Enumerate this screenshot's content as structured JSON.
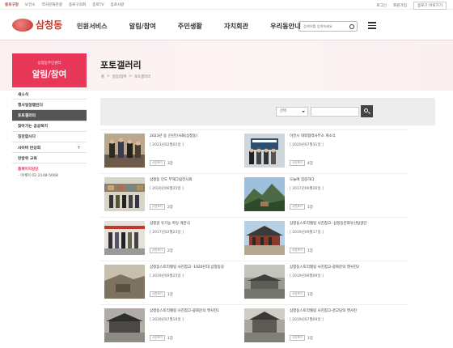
{
  "utility": {
    "left": [
      "중로구청",
      "보건소",
      "역사문화관광",
      "종로구의회",
      "종로TV",
      "종로사랑"
    ],
    "right": [
      "로그인",
      "회원가입"
    ],
    "dropdown": "종로구 바로가기"
  },
  "header": {
    "logo": "삼청동",
    "nav": [
      "민원서비스",
      "알림/참여",
      "주민생활",
      "자치회관",
      "우리동안내"
    ],
    "search_placeholder": "검색어를 입력하세요"
  },
  "visual": {
    "side_sub": "삼청동주민센터",
    "side_title": "알림/참여",
    "page_title": "포토갤러리",
    "breadcrumb": [
      "홈",
      ">",
      "알림/참여",
      ">",
      "포토갤러리"
    ]
  },
  "sidemenu": {
    "items": [
      {
        "label": "새소식",
        "plus": ""
      },
      {
        "label": "행사일정캘린더",
        "plus": ""
      },
      {
        "label": "포토갤러리",
        "plus": ""
      },
      {
        "label": "찾아가는 공공복지",
        "plus": ""
      },
      {
        "label": "칭찬합시다",
        "plus": ""
      },
      {
        "label": "사이버 반상회",
        "plus": "+"
      },
      {
        "label": "민방위 교육",
        "plus": ""
      }
    ],
    "contact_title": "홈페이지담당",
    "contact_phone": "- 이메이 02-2148-5068"
  },
  "search": {
    "select": "선택",
    "input": ""
  },
  "gallery": [
    {
      "title": "2023년 동 신년인사회(삼청동)",
      "date": "[ 2023년02월02일 ]",
      "badge": "사진보기",
      "count": "3장"
    },
    {
      "title": "이전시 대외협력사무소 개소식",
      "date": "[ 2020년07월31일 ]",
      "badge": "사진보기",
      "count": "4장"
    },
    {
      "title": "삼청동 인도 부해그림전시회",
      "date": "[ 2020년06월25일 ]",
      "badge": "사진보기",
      "count": "2장"
    },
    {
      "title": "오늘에 집중하다",
      "date": "[ 2017년06월26일 ]",
      "badge": "사진보기",
      "count": "1장"
    },
    {
      "title": "삼청골 유기농 마당 개관식",
      "date": "[ 2017년02월23일 ]",
      "badge": "사진보기",
      "count": "2장"
    },
    {
      "title": "삼청동스토리텔링 사진참고- 삼청동문화유산탐골단",
      "date": "[ 2019년09월17일 ]",
      "badge": "사진보기",
      "count": "1장"
    },
    {
      "title": "삼청동스토리텔링 사진참고- 1920년대 삼청동길",
      "date": "[ 2019년09월25일 ]",
      "badge": "사진보기",
      "count": "1장"
    },
    {
      "title": "삼청동스토리텔링 사진참고-광화문의 옛사진2",
      "date": "[ 2019년09월09일 ]",
      "badge": "사진보기",
      "count": "1장"
    },
    {
      "title": "삼청동스토리텔링 사진참고-광화문의 옛사진1",
      "date": "[ 2019년07월10일 ]",
      "badge": "사진보기",
      "count": "1장"
    },
    {
      "title": "삼청동스토리텔링 사진참고-경고당의 옛사진",
      "date": "[ 2019년07월09일 ]",
      "badge": "사진보기",
      "count": "1장"
    }
  ],
  "colors": {
    "accent": "#e8385a",
    "logo": "#c0392b",
    "sidemenu_active": "#555555"
  }
}
